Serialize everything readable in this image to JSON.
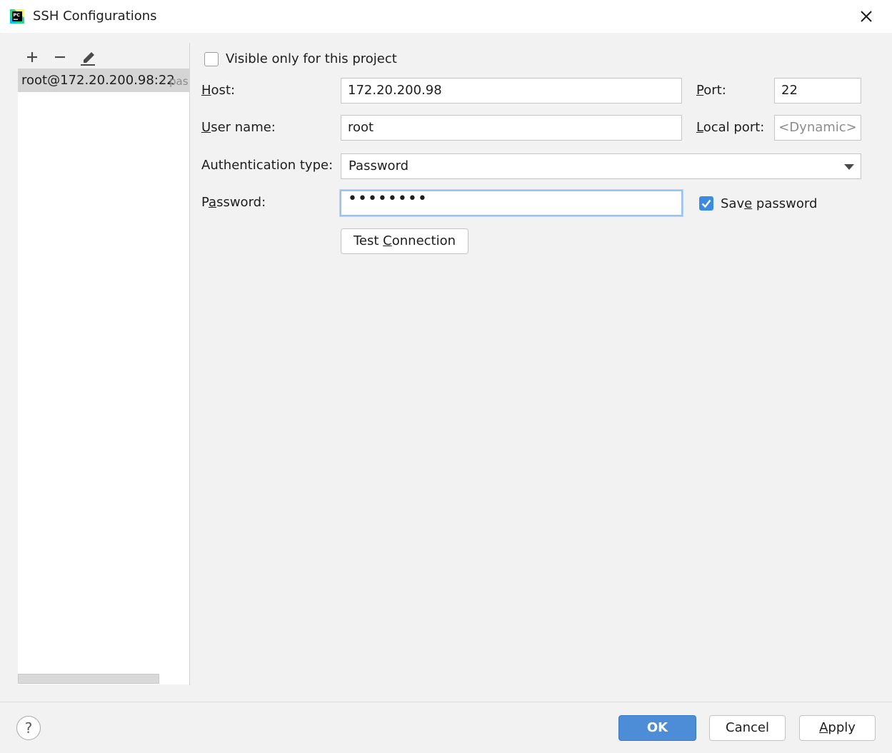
{
  "window": {
    "title": "SSH Configurations"
  },
  "icons": {
    "app": "pycharm-icon",
    "close": "close-icon",
    "add": "plus-icon",
    "remove": "minus-icon",
    "edit": "pencil-icon",
    "dropdown": "chevron-down-icon",
    "check": "checkmark-icon"
  },
  "list": {
    "items": [
      {
        "host": "root@172.20.200.98:22",
        "auth": "pas"
      }
    ]
  },
  "form": {
    "visible_only_label": "Visible only for this project",
    "visible_only_checked": false,
    "host_label": "Host:",
    "host_value": "172.20.200.98",
    "port_label": "Port:",
    "port_value": "22",
    "username_label": "User name:",
    "username_value": "root",
    "local_port_label": "Local port:",
    "local_port_placeholder": "<Dynamic>",
    "auth_type_label": "Authentication type:",
    "auth_type_value": "Password",
    "password_label": "Password:",
    "password_value": "••••••••",
    "save_password_label": "Save password",
    "save_password_checked": true,
    "test_connection_label": "Test Connection"
  },
  "footer": {
    "help_label": "?",
    "ok_label": "OK",
    "cancel_label": "Cancel",
    "apply_label": "Apply"
  },
  "colors": {
    "accent": "#4d8cd6",
    "checkbox": "#3d8ae2",
    "focus": "#97c3f3",
    "selection": "#d5d5d5"
  }
}
